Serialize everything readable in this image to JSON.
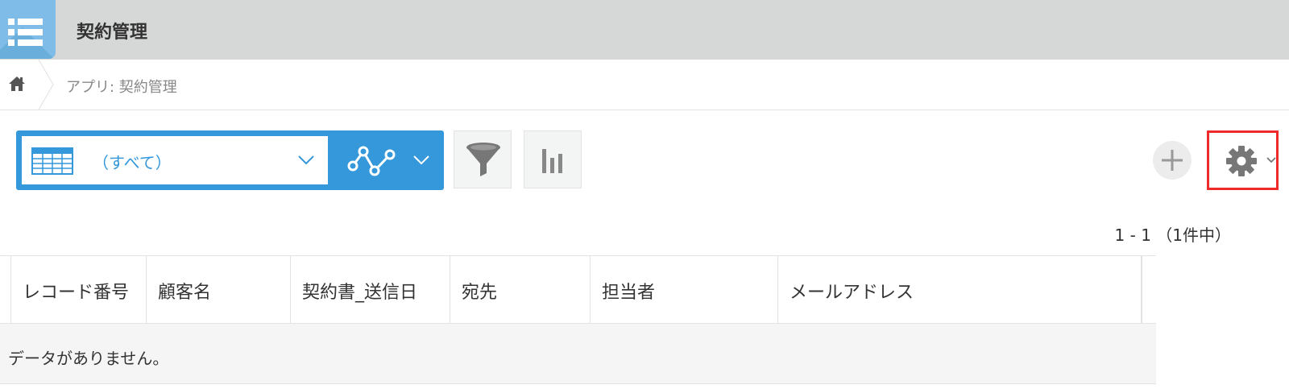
{
  "app": {
    "title": "契約管理"
  },
  "breadcrumb": {
    "current": "アプリ: 契約管理"
  },
  "view": {
    "selected": "（すべて）"
  },
  "pager": {
    "text": "1 - 1 （1件中）"
  },
  "table": {
    "columns": [
      "レコード番号",
      "顧客名",
      "契約書_送信日",
      "宛先",
      "担当者",
      "メールアドレス"
    ],
    "empty_message": "データがありません。"
  },
  "icons": {
    "app": "app-list-icon",
    "home": "home-icon",
    "table": "table-view-icon",
    "graph": "graph-icon",
    "filter": "filter-icon",
    "chart": "bar-chart-icon",
    "add": "plus-icon",
    "settings": "gear-icon",
    "chevron": "chevron-down-icon"
  },
  "colors": {
    "accent": "#3498db",
    "header_bg": "#d6d7d7",
    "highlight": "#ee2a2a"
  }
}
